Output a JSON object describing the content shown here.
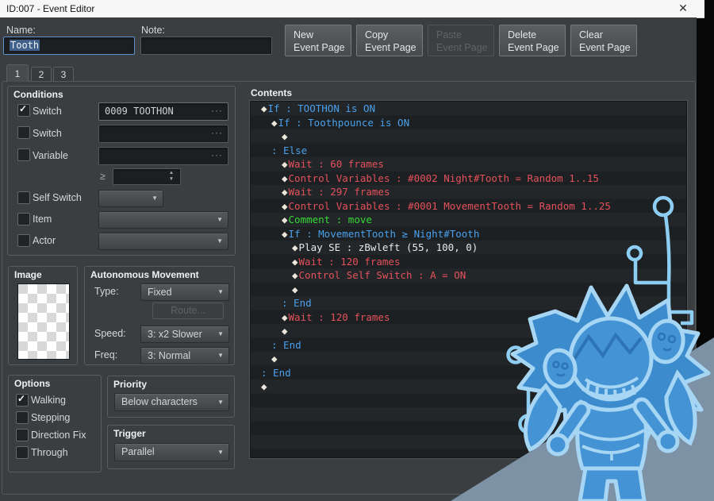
{
  "window": {
    "title": "ID:007 - Event Editor"
  },
  "icons": {
    "close": "✕",
    "check": "✓",
    "dropdown": "▼",
    "ellipsis": "···",
    "spin_up": "▲",
    "spin_down": "▼",
    "diamond": "◆"
  },
  "header": {
    "name_label": "Name:",
    "name_value": "Tooth",
    "note_label": "Note:",
    "note_value": ""
  },
  "toolbar": {
    "buttons": [
      {
        "label": "New\nEvent Page",
        "enabled": true
      },
      {
        "label": "Copy\nEvent Page",
        "enabled": true
      },
      {
        "label": "Paste\nEvent Page",
        "enabled": false
      },
      {
        "label": "Delete\nEvent Page",
        "enabled": true
      },
      {
        "label": "Clear\nEvent Page",
        "enabled": true
      }
    ]
  },
  "tabs": [
    {
      "label": "1",
      "active": true
    },
    {
      "label": "2",
      "active": false
    },
    {
      "label": "3",
      "active": false
    }
  ],
  "conditions": {
    "title": "Conditions",
    "switch1": {
      "label": "Switch",
      "checked": true,
      "value": "0009 TOOTHON"
    },
    "switch2": {
      "label": "Switch",
      "checked": false,
      "value": ""
    },
    "variable": {
      "label": "Variable",
      "checked": false,
      "value": "",
      "operator": "≥",
      "operand": ""
    },
    "self_switch": {
      "label": "Self Switch",
      "checked": false,
      "value": ""
    },
    "item": {
      "label": "Item",
      "checked": false,
      "value": ""
    },
    "actor": {
      "label": "Actor",
      "checked": false,
      "value": ""
    }
  },
  "image_panel": {
    "title": "Image"
  },
  "movement": {
    "title": "Autonomous Movement",
    "type_label": "Type:",
    "type_value": "Fixed",
    "route_label": "Route...",
    "speed_label": "Speed:",
    "speed_value": "3: x2 Slower",
    "freq_label": "Freq:",
    "freq_value": "3: Normal"
  },
  "options": {
    "title": "Options",
    "items": [
      {
        "label": "Walking",
        "checked": true
      },
      {
        "label": "Stepping",
        "checked": false
      },
      {
        "label": "Direction Fix",
        "checked": false
      },
      {
        "label": "Through",
        "checked": false
      }
    ]
  },
  "priority": {
    "title": "Priority",
    "value": "Below characters"
  },
  "trigger": {
    "title": "Trigger",
    "value": "Parallel"
  },
  "contents": {
    "title": "Contents",
    "lines": [
      {
        "indent": 0,
        "type": "cmd",
        "color": "blue",
        "text": "If : TOOTHON is ON"
      },
      {
        "indent": 1,
        "type": "cmd",
        "color": "blue",
        "text": "If : Toothpounce is ON"
      },
      {
        "indent": 2,
        "type": "cmd",
        "color": "white",
        "text": ""
      },
      {
        "indent": 1,
        "type": "branch",
        "color": "blue",
        "text": "Else"
      },
      {
        "indent": 2,
        "type": "cmd",
        "color": "red",
        "text": "Wait : 60 frames"
      },
      {
        "indent": 2,
        "type": "cmd",
        "color": "red",
        "text": "Control Variables : #0002 Night#Tooth = Random 1..15"
      },
      {
        "indent": 2,
        "type": "cmd",
        "color": "red",
        "text": "Wait : 297 frames"
      },
      {
        "indent": 2,
        "type": "cmd",
        "color": "red",
        "text": "Control Variables : #0001 MovementTooth = Random 1..25"
      },
      {
        "indent": 2,
        "type": "cmd",
        "color": "green",
        "text": "Comment : move"
      },
      {
        "indent": 2,
        "type": "cmd",
        "color": "blue",
        "text": "If : MovementTooth ≥ Night#Tooth"
      },
      {
        "indent": 3,
        "type": "cmd",
        "color": "white",
        "text": "Play SE : zBwleft (55, 100, 0)"
      },
      {
        "indent": 3,
        "type": "cmd",
        "color": "red",
        "text": "Wait : 120 frames"
      },
      {
        "indent": 3,
        "type": "cmd",
        "color": "red",
        "text": "Control Self Switch : A = ON"
      },
      {
        "indent": 3,
        "type": "cmd",
        "color": "white",
        "text": ""
      },
      {
        "indent": 2,
        "type": "branch",
        "color": "blue",
        "text": "End"
      },
      {
        "indent": 2,
        "type": "cmd",
        "color": "red",
        "text": "Wait : 120 frames"
      },
      {
        "indent": 2,
        "type": "cmd",
        "color": "white",
        "text": ""
      },
      {
        "indent": 1,
        "type": "branch",
        "color": "blue",
        "text": "End"
      },
      {
        "indent": 1,
        "type": "cmd",
        "color": "white",
        "text": ""
      },
      {
        "indent": 0,
        "type": "branch",
        "color": "blue",
        "text": "End"
      },
      {
        "indent": 0,
        "type": "cmd",
        "color": "white",
        "text": ""
      }
    ]
  },
  "colors": {
    "cmd_blue": "#4aa0ec",
    "cmd_red": "#e4515c",
    "cmd_green": "#35d935",
    "cmd_white": "#e8e8e6",
    "diamond": "#ece6da",
    "selection_bg": "#41618c",
    "focus_border": "#5e93cd",
    "sketch_fill": "#4493d4",
    "sketch_outline": "#a6d6f4",
    "sketch_triangle": "#7d92a5"
  }
}
